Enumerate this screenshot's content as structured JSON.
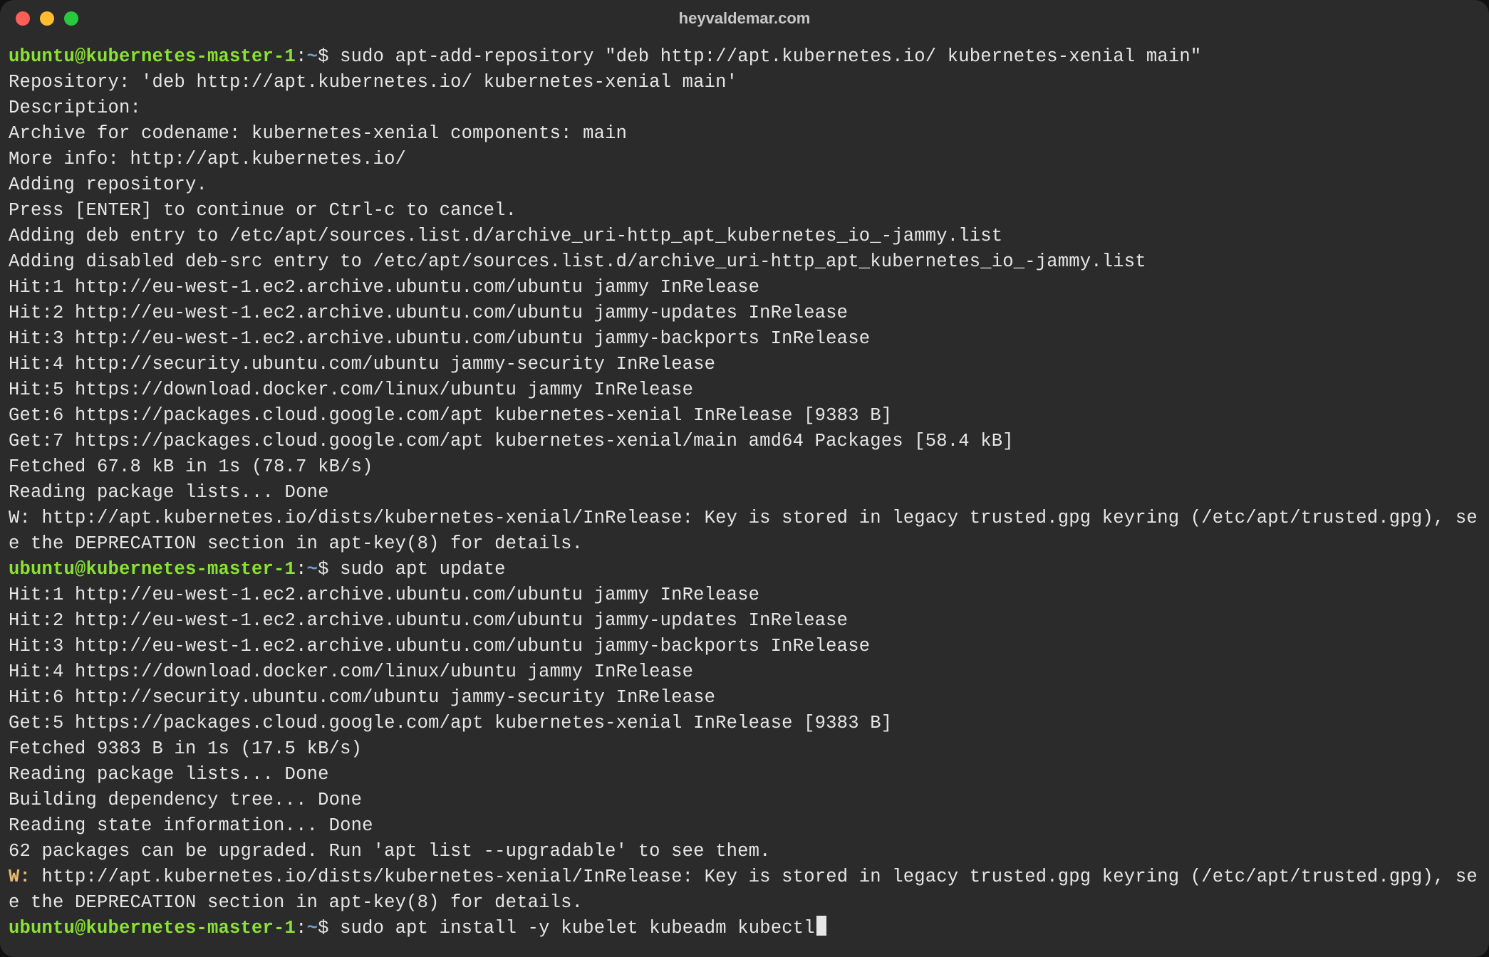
{
  "title": "heyvaldemar.com",
  "prompt": {
    "user": "ubuntu@kubernetes-master-1",
    "sep": ":",
    "path": "~",
    "dollar": "$"
  },
  "block1": {
    "cmd": "sudo apt-add-repository \"deb http://apt.kubernetes.io/ kubernetes-xenial main\"",
    "lines": [
      "Repository: 'deb http://apt.kubernetes.io/ kubernetes-xenial main'",
      "Description:",
      "Archive for codename: kubernetes-xenial components: main",
      "More info: http://apt.kubernetes.io/",
      "Adding repository.",
      "Press [ENTER] to continue or Ctrl-c to cancel.",
      "Adding deb entry to /etc/apt/sources.list.d/archive_uri-http_apt_kubernetes_io_-jammy.list",
      "Adding disabled deb-src entry to /etc/apt/sources.list.d/archive_uri-http_apt_kubernetes_io_-jammy.list",
      "Hit:1 http://eu-west-1.ec2.archive.ubuntu.com/ubuntu jammy InRelease",
      "Hit:2 http://eu-west-1.ec2.archive.ubuntu.com/ubuntu jammy-updates InRelease",
      "Hit:3 http://eu-west-1.ec2.archive.ubuntu.com/ubuntu jammy-backports InRelease",
      "Hit:4 http://security.ubuntu.com/ubuntu jammy-security InRelease",
      "Hit:5 https://download.docker.com/linux/ubuntu jammy InRelease",
      "Get:6 https://packages.cloud.google.com/apt kubernetes-xenial InRelease [9383 B]",
      "Get:7 https://packages.cloud.google.com/apt kubernetes-xenial/main amd64 Packages [58.4 kB]",
      "Fetched 67.8 kB in 1s (78.7 kB/s)",
      "Reading package lists... Done",
      "W: http://apt.kubernetes.io/dists/kubernetes-xenial/InRelease: Key is stored in legacy trusted.gpg keyring (/etc/apt/trusted.gpg), see the DEPRECATION section in apt-key(8) for details."
    ]
  },
  "block2": {
    "cmd": "sudo apt update",
    "lines": [
      "Hit:1 http://eu-west-1.ec2.archive.ubuntu.com/ubuntu jammy InRelease",
      "Hit:2 http://eu-west-1.ec2.archive.ubuntu.com/ubuntu jammy-updates InRelease",
      "Hit:3 http://eu-west-1.ec2.archive.ubuntu.com/ubuntu jammy-backports InRelease",
      "Hit:4 https://download.docker.com/linux/ubuntu jammy InRelease",
      "Hit:6 http://security.ubuntu.com/ubuntu jammy-security InRelease",
      "Get:5 https://packages.cloud.google.com/apt kubernetes-xenial InRelease [9383 B]",
      "Fetched 9383 B in 1s (17.5 kB/s)",
      "Reading package lists... Done",
      "Building dependency tree... Done",
      "Reading state information... Done",
      "62 packages can be upgraded. Run 'apt list --upgradable' to see them."
    ],
    "warn_prefix": "W:",
    "warn_rest": " http://apt.kubernetes.io/dists/kubernetes-xenial/InRelease: Key is stored in legacy trusted.gpg keyring (/etc/apt/trusted.gpg), see the DEPRECATION section in apt-key(8) for details."
  },
  "block3": {
    "cmd": "sudo apt install -y kubelet kubeadm kubectl"
  }
}
